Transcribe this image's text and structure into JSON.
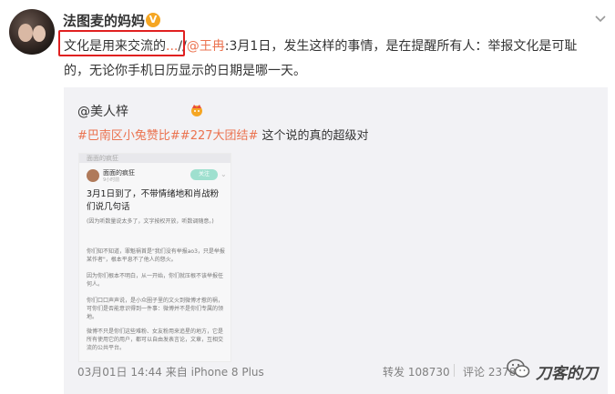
{
  "post": {
    "username": "法图麦的妈妈",
    "verified_badge": "V",
    "text_highlight": "文化是用来交流的",
    "text_ellipsis": "...",
    "text_sep": "//",
    "mention": "@王冉",
    "text_rest_line1": ":3月1日，发生这样的事情，是在提醒所有人：举报文化是可耻",
    "text_line2": "的，无论你手机日历显示的日期是哪一天。"
  },
  "repost": {
    "user": "@美人梓",
    "topic1": "#巴南区小兔赞比#",
    "topic2": "#227大团结#",
    "text": " 这个说的真的超级对",
    "image": {
      "top_label": "面面的疯狂",
      "author": "面面的疯狂",
      "author_sub": "9小时前",
      "follow": "关注",
      "title": "3月1日到了，不带情绪地和肖战粉们说几句话",
      "p1": "(因为听数量说太多了，文字按权开放，听数调随意。)",
      "p2": "你们知不知道，罪魁祸首是\"我们没有举报ao3，只是举报某作者\"，根本平息不了他人的怒火。",
      "p3": "因为你们根本不明白，从一开始，你们就压根不该举报任何人。",
      "p4": "你们口口声声说，是小众圈子里的文火到微博才惹的祸，可你们是否能意识得到一件事：微博并不是你们专属的领地。",
      "p5": "微博不只是你们这些难粉、女友粉用来追星的地方，它是所有使用它的用户，都可以自由发表言论，文章，互相交流的公共平台。"
    },
    "meta": "03月01日 14:44 来自 iPhone 8 Plus",
    "forward": "转发 108730",
    "comment": "评论 2378"
  },
  "watermark": {
    "text": "刀客的刀",
    "icon": "wechat-icon"
  },
  "icons": {
    "more": "chevron-down-icon",
    "crown": "crown-icon"
  },
  "colors": {
    "link": "#eb7350",
    "highlight_border": "#e02020",
    "repost_bg": "#f2f2f5"
  }
}
